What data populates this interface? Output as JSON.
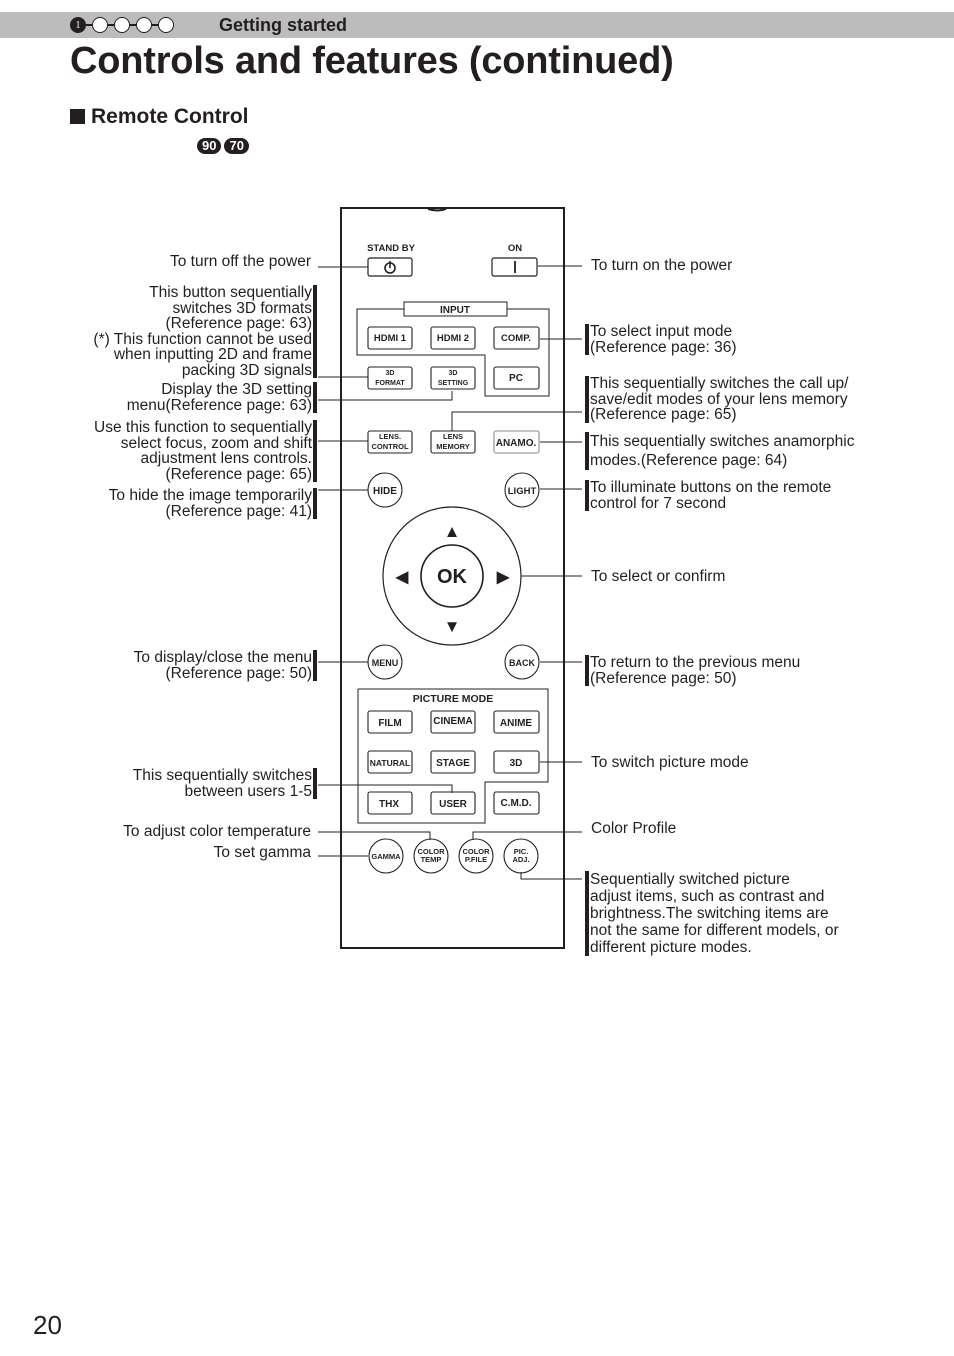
{
  "header": {
    "steps": [
      "1",
      "",
      "",
      "",
      ""
    ],
    "active_step": 1,
    "section": "Getting started"
  },
  "title": "Controls and features (continued)",
  "subtitle": "Remote Control",
  "model_badges": [
    "90",
    "70"
  ],
  "remote": {
    "standby_label": "STAND BY",
    "on_label": "ON",
    "input_group_label": "INPUT",
    "buttons": {
      "hdmi1": "HDMI 1",
      "hdmi2": "HDMI 2",
      "comp": "COMP.",
      "pc": "PC",
      "format3d": [
        "3D",
        "FORMAT"
      ],
      "setting3d": [
        "3D",
        "SETTING"
      ],
      "lens_control": [
        "LENS.",
        "CONTROL"
      ],
      "lens_memory": [
        "LENS",
        "MEMORY"
      ],
      "anamo": "ANAMO.",
      "hide": "HIDE",
      "light": "LIGHT",
      "ok": "OK",
      "menu": "MENU",
      "back": "BACK",
      "film": "FILM",
      "cinema": "CINEMA",
      "anime": "ANIME",
      "natural": "NATURAL",
      "stage": "STAGE",
      "3d": "3D",
      "thx": "THX",
      "user": "USER",
      "cmd": "C.M.D.",
      "gamma": "GAMMA",
      "color_temp": [
        "COLOR",
        "TEMP"
      ],
      "color_pfile": [
        "COLOR",
        "P.FILE"
      ],
      "pic_adj": [
        "PIC.",
        "ADJ."
      ]
    },
    "picture_mode_label": "PICTURE MODE",
    "arrows": {
      "up": "▲",
      "down": "▼",
      "left": "◀",
      "right": "▶"
    }
  },
  "annotations_left": {
    "standby": [
      "To turn off the power"
    ],
    "format3d": [
      "This button sequentially",
      "switches 3D formats",
      "(Reference page: 63)",
      "(*) This function cannot be used",
      "when inputting 2D and frame",
      "packing 3D signals"
    ],
    "setting3d": [
      "Display the 3D setting",
      "menu(Reference page: 63)"
    ],
    "lens_control": [
      "Use this function to sequentially",
      "select focus, zoom and shift",
      "adjustment lens controls.",
      "(Reference page: 65)"
    ],
    "hide": [
      "To hide the image temporarily",
      "(Reference page: 41)"
    ],
    "menu": [
      "To display/close the menu",
      "(Reference page: 50)"
    ],
    "user": [
      "This sequentially switches",
      "between users 1-5"
    ],
    "color_temp": [
      "To adjust color temperature"
    ],
    "gamma": [
      "To set gamma"
    ]
  },
  "annotations_right": {
    "on": [
      "To turn on the power"
    ],
    "input": [
      "To select input mode",
      "(Reference page: 36)"
    ],
    "lens_memory": [
      "This sequentially switches the call up/",
      "save/edit modes of your lens memory",
      "(Reference page: 65)"
    ],
    "anamo": [
      "This sequentially switches anamorphic",
      "modes.(Reference page: 64)"
    ],
    "light": [
      "To illuminate buttons on the remote",
      "control for 7 second"
    ],
    "ok": [
      "To select or confirm"
    ],
    "back": [
      "To return to the previous menu",
      "(Reference page: 50)"
    ],
    "picture_mode": [
      "To switch picture mode"
    ],
    "color_profile": [
      "Color Profile"
    ],
    "pic_adj": [
      "Sequentially switched picture",
      "adjust items, such as contrast and",
      "brightness.The switching items are",
      "not the same for different models, or",
      "different picture modes."
    ]
  },
  "page_number": "20"
}
